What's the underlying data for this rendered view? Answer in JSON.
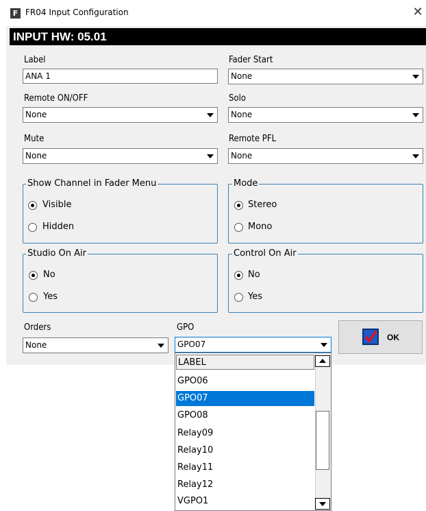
{
  "window": {
    "title": "FR04 Input Configuration",
    "icon_letter": "F",
    "close_glyph": "✕"
  },
  "header": "INPUT HW: 05.01",
  "fields": {
    "label": {
      "caption": "Label",
      "value": "ANA 1"
    },
    "fader_start": {
      "caption": "Fader Start",
      "value": "None"
    },
    "remote_onoff": {
      "caption": "Remote ON/OFF",
      "value": "None"
    },
    "solo": {
      "caption": "Solo",
      "value": "None"
    },
    "mute": {
      "caption": "Mute",
      "value": "None"
    },
    "remote_pfl": {
      "caption": "Remote PFL",
      "value": "None"
    },
    "orders": {
      "caption": "Orders",
      "value": "None"
    },
    "gpo": {
      "caption": "GPO",
      "value": "GPO07"
    }
  },
  "groups": {
    "show_channel": {
      "title": "Show Channel in Fader Menu",
      "options": [
        "Visible",
        "Hidden"
      ],
      "selected": "Visible"
    },
    "mode": {
      "title": "Mode",
      "options": [
        "Stereo",
        "Mono"
      ],
      "selected": "Stereo"
    },
    "studio_on_air": {
      "title": "Studio On Air",
      "options": [
        "No",
        "Yes"
      ],
      "selected": "No"
    },
    "control_on_air": {
      "title": "Control On Air",
      "options": [
        "No",
        "Yes"
      ],
      "selected": "No"
    }
  },
  "ok_button": {
    "label": "OK"
  },
  "gpo_dropdown": {
    "items": [
      "LABEL",
      "GPO06",
      "GPO07",
      "GPO08",
      "Relay09",
      "Relay10",
      "Relay11",
      "Relay12",
      "VGPO1"
    ],
    "selected": "GPO07"
  },
  "colors": {
    "selection": "#0078d7",
    "group_border": "#3c7fb1",
    "header_bg": "#000000"
  }
}
